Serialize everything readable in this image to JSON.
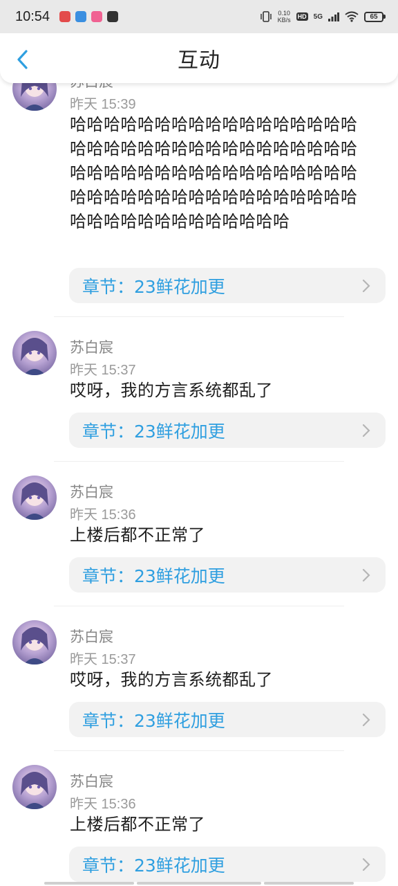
{
  "status_bar": {
    "time": "10:54",
    "net_speed_value": "0.10",
    "net_speed_unit": "KB/s",
    "hd": "HD",
    "signal": "5G",
    "battery": "65",
    "icons": [
      "calendar-app-icon",
      "browser-app-icon",
      "video-app-icon",
      "message-app-icon",
      "vibrate-icon",
      "signal-icon",
      "wifi-icon",
      "battery-icon"
    ]
  },
  "header": {
    "title": "互动",
    "back_icon": "chevron-left-icon"
  },
  "colors": {
    "accent": "#2f9fe0",
    "pill_bg": "#f2f2f2",
    "meta_text": "#9a9a9a"
  },
  "comments": [
    {
      "username": "苏白宸",
      "time": "昨天 15:39",
      "content": "哈哈哈哈哈哈哈哈哈哈哈哈哈哈哈哈哈哈哈哈哈哈哈哈哈哈哈哈哈哈哈哈哈哈哈哈哈哈哈哈哈哈哈哈哈哈哈哈哈哈哈哈哈哈哈哈哈哈哈哈哈哈哈哈哈哈哈哈哈哈哈哈哈哈哈哈哈哈哈哈哈",
      "chapter": "章节：23鲜花加更"
    },
    {
      "username": "苏白宸",
      "time": "昨天 15:37",
      "content": "哎呀，我的方言系统都乱了",
      "chapter": "章节：23鲜花加更"
    },
    {
      "username": "苏白宸",
      "time": "昨天 15:36",
      "content": "上楼后都不正常了",
      "chapter": "章节：23鲜花加更"
    },
    {
      "username": "苏白宸",
      "time": "昨天 15:37",
      "content": "哎呀，我的方言系统都乱了",
      "chapter": "章节：23鲜花加更"
    },
    {
      "username": "苏白宸",
      "time": "昨天 15:36",
      "content": "上楼后都不正常了",
      "chapter": "章节：23鲜花加更"
    }
  ]
}
